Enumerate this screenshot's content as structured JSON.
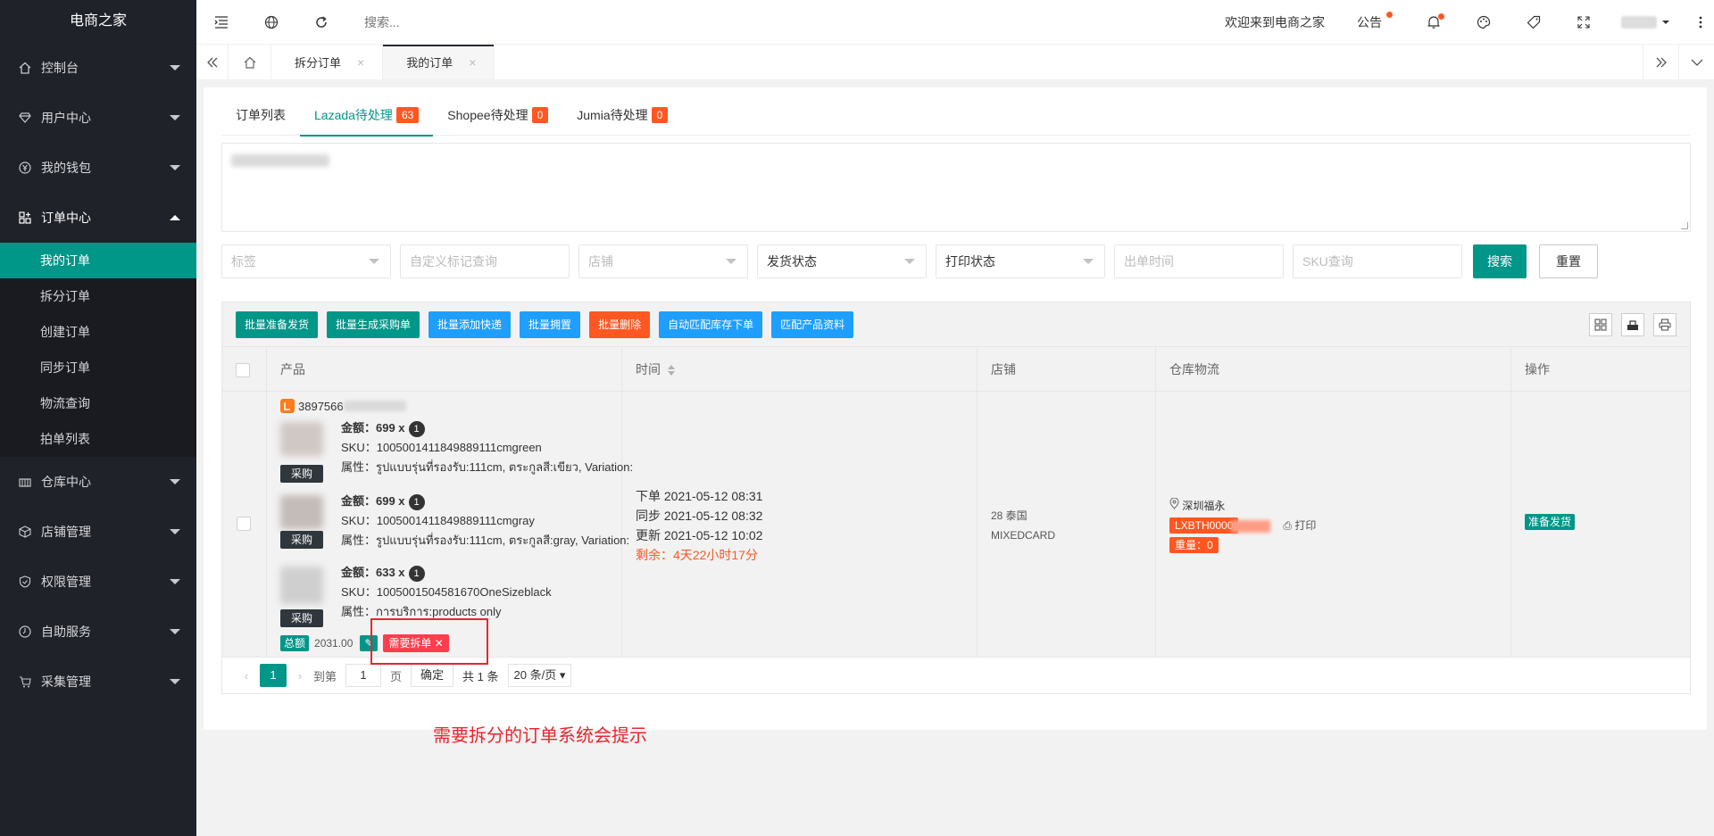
{
  "app": {
    "title": "电商之家"
  },
  "sidebar": {
    "items": [
      {
        "label": "控制台",
        "icon": "home-icon"
      },
      {
        "label": "用户中心",
        "icon": "diamond-icon"
      },
      {
        "label": "我的钱包",
        "icon": "yen-icon"
      },
      {
        "label": "订单中心",
        "icon": "apps-icon"
      },
      {
        "label": "仓库中心",
        "icon": "warehouse-icon"
      },
      {
        "label": "店铺管理",
        "icon": "box-icon"
      },
      {
        "label": "权限管理",
        "icon": "shield-icon"
      },
      {
        "label": "自助服务",
        "icon": "service-icon"
      },
      {
        "label": "采集管理",
        "icon": "cart-icon"
      }
    ],
    "sub_items": [
      "我的订单",
      "拆分订单",
      "创建订单",
      "同步订单",
      "物流查询",
      "拍单列表"
    ]
  },
  "topbar": {
    "search_placeholder": "搜索...",
    "welcome": "欢迎来到电商之家",
    "notice": "公告"
  },
  "page_tabs": [
    {
      "label": "拆分订单"
    },
    {
      "label": "我的订单"
    }
  ],
  "order_tabs": [
    {
      "label": "订单列表",
      "count": ""
    },
    {
      "label": "Lazada待处理",
      "count": "63"
    },
    {
      "label": "Shopee待处理",
      "count": "0"
    },
    {
      "label": "Jumia待处理",
      "count": "0"
    }
  ],
  "filters": {
    "tag": "标签",
    "custom_mark": "自定义标记查询",
    "shop": "店铺",
    "ship_status": "发货状态",
    "print_status": "打印状态",
    "ship_time": "出单时间",
    "sku": "SKU查询",
    "search_btn": "搜索",
    "reset_btn": "重置"
  },
  "toolbar": {
    "buttons": [
      "批量准备发货",
      "批量生成采购单",
      "批量添加快递",
      "批量拥置",
      "批量删除",
      "自动匹配库存下单",
      "匹配产品资料"
    ]
  },
  "table": {
    "headers": [
      "产品",
      "时间",
      "店铺",
      "仓库物流",
      "操作"
    ],
    "row": {
      "order_no": "3897566",
      "items": [
        {
          "amount": "金额：699 x",
          "qty": "1",
          "sku": "SKU：1005001411849889111cmgreen",
          "attr": "属性：รูปแบบรุ่นที่รองรับ:111cm, ตระกูลสี:เขียว, Variation:",
          "buy": "采购"
        },
        {
          "amount": "金额：699 x",
          "qty": "1",
          "sku": "SKU：1005001411849889111cmgray",
          "attr": "属性：รูปแบบรุ่นที่รองรับ:111cm, ตระกูลสี:gray, Variation:",
          "buy": "采购"
        },
        {
          "amount": "金额：633 x",
          "qty": "1",
          "sku": "SKU：1005001504581670OneSizeblack",
          "attr": "属性：การบริการ:products only",
          "buy": "采购"
        }
      ],
      "total_label": "总额",
      "total_value": "2031.00",
      "split_tag": "需要拆单 ✕",
      "times": {
        "order": "下单 2021-05-12 08:31",
        "sync": "同步 2021-05-12 08:32",
        "update": "更新 2021-05-12 10:02",
        "remaining": "剩余：4天22小时17分"
      },
      "shop": {
        "line1": "28   泰国",
        "line2": "MIXEDCARD"
      },
      "warehouse": {
        "location": "深圳福永",
        "tracking": "LXBTH0000",
        "print": "打印",
        "weight": "重量：0"
      },
      "action": "准备发货"
    }
  },
  "pager": {
    "current": "1",
    "goto_label": "到第",
    "goto_value": "1",
    "page_label": "页",
    "confirm": "确定",
    "total": "共 1 条",
    "size": "20 条/页"
  },
  "annotation": "需要拆分的订单系统会提示",
  "colors": {
    "accent": "#009688",
    "danger": "#ff5722",
    "info": "#1e9fff",
    "sidebar": "#20222a"
  }
}
